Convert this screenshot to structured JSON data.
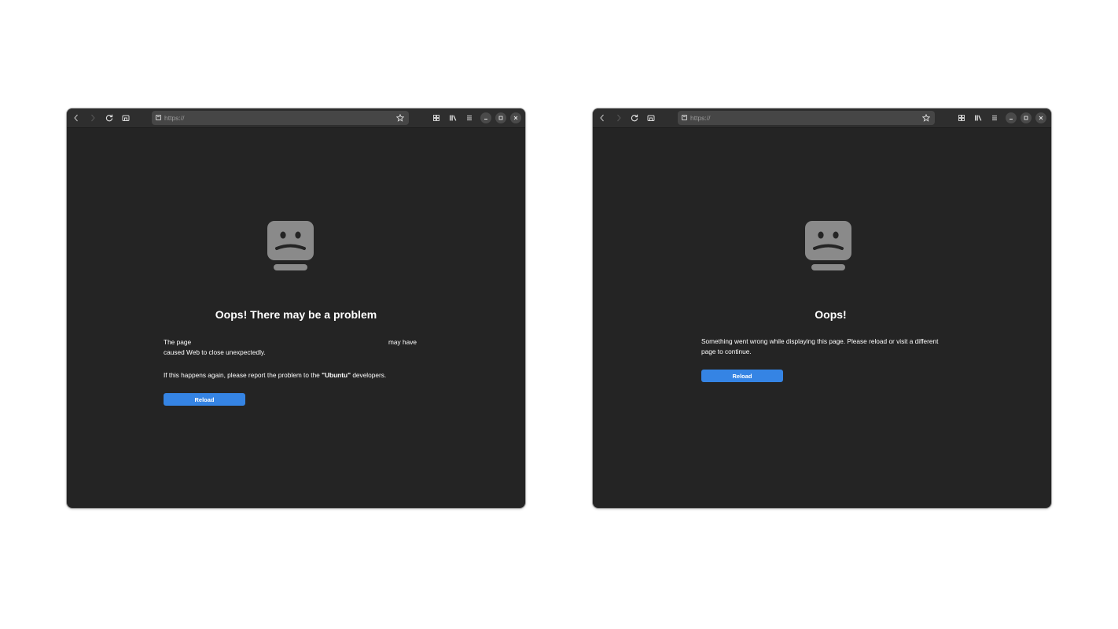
{
  "url_placeholder": "https://",
  "left": {
    "title": "Oops! There may be a problem",
    "page_prefix": "The page",
    "page_suffix": "may have",
    "line2": "caused Web to close unexpectedly.",
    "report_prefix": "If this happens again, please report the problem to the ",
    "report_vendor": "\"Ubuntu\"",
    "report_suffix": " developers.",
    "reload_label": "Reload"
  },
  "right": {
    "title": "Oops!",
    "message": "Something went wrong while displaying this page. Please reload or visit a different page to continue.",
    "reload_label": "Reload"
  },
  "colors": {
    "window_bg": "#242424",
    "headerbar_bg": "#2e2e2e",
    "urlbar_bg": "#464646",
    "accent": "#3584e4",
    "sad_face": "#8a8a8a"
  },
  "icons": [
    "back-icon",
    "forward-icon",
    "reload-icon",
    "reader-mode-icon",
    "site-info-icon",
    "bookmark-star-icon",
    "tabs-overview-icon",
    "library-icon",
    "menu-icon",
    "minimize-icon",
    "maximize-icon",
    "close-icon",
    "sad-face-icon"
  ]
}
